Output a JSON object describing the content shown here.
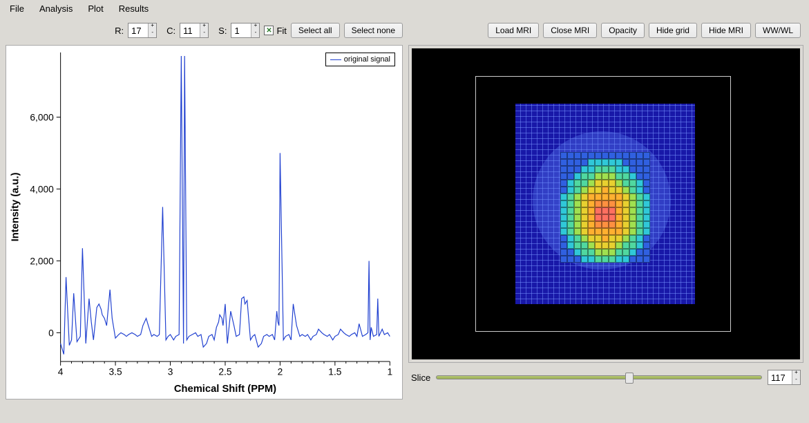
{
  "menu": {
    "file": "File",
    "analysis": "Analysis",
    "plot": "Plot",
    "results": "Results"
  },
  "spinners": {
    "r_label": "R:",
    "r_value": "17",
    "c_label": "C:",
    "c_value": "11",
    "s_label": "S:",
    "s_value": "1"
  },
  "fit_checkbox": {
    "label": "Fit",
    "checked": true
  },
  "buttons": {
    "select_all": "Select all",
    "select_none": "Select none",
    "load_mri": "Load MRI",
    "close_mri": "Close MRI",
    "opacity": "Opacity",
    "hide_grid": "Hide grid",
    "hide_mri": "Hide MRI",
    "wwwl": "WW/WL"
  },
  "legend": "original signal",
  "axes": {
    "x": "Chemical Shift (PPM)",
    "y": "Intensity (a.u.)"
  },
  "slice": {
    "label": "Slice",
    "value": "117"
  },
  "chart_data": {
    "type": "line",
    "title": "",
    "xlabel": "Chemical Shift (PPM)",
    "ylabel": "Intensity (a.u.)",
    "xlim": [
      4.0,
      1.0
    ],
    "ylim": [
      -800,
      7800
    ],
    "x_ticks": [
      4,
      3.5,
      3,
      2.5,
      2,
      1.5,
      1
    ],
    "y_ticks": [
      0,
      2000,
      4000,
      6000
    ],
    "y_tick_labels": [
      "0",
      "2,000",
      "4,000",
      "6,000"
    ],
    "series": [
      {
        "name": "original signal",
        "x": [
          4.0,
          3.97,
          3.95,
          3.92,
          3.9,
          3.88,
          3.85,
          3.82,
          3.8,
          3.77,
          3.74,
          3.72,
          3.7,
          3.67,
          3.65,
          3.63,
          3.62,
          3.6,
          3.58,
          3.55,
          3.53,
          3.5,
          3.47,
          3.45,
          3.42,
          3.4,
          3.38,
          3.35,
          3.32,
          3.3,
          3.27,
          3.25,
          3.22,
          3.2,
          3.17,
          3.15,
          3.12,
          3.1,
          3.07,
          3.04,
          3.02,
          3.0,
          2.97,
          2.95,
          2.92,
          2.9,
          2.88,
          2.87,
          2.85,
          2.83,
          2.8,
          2.77,
          2.75,
          2.72,
          2.7,
          2.67,
          2.65,
          2.62,
          2.6,
          2.58,
          2.56,
          2.55,
          2.53,
          2.52,
          2.5,
          2.48,
          2.45,
          2.42,
          2.4,
          2.37,
          2.35,
          2.33,
          2.32,
          2.3,
          2.27,
          2.25,
          2.23,
          2.2,
          2.17,
          2.15,
          2.12,
          2.1,
          2.07,
          2.05,
          2.03,
          2.02,
          2.01,
          2.0,
          1.97,
          1.95,
          1.92,
          1.9,
          1.88,
          1.87,
          1.85,
          1.82,
          1.8,
          1.77,
          1.75,
          1.72,
          1.7,
          1.67,
          1.65,
          1.62,
          1.6,
          1.57,
          1.55,
          1.52,
          1.5,
          1.47,
          1.45,
          1.42,
          1.4,
          1.37,
          1.35,
          1.32,
          1.3,
          1.28,
          1.25,
          1.22,
          1.2,
          1.19,
          1.18,
          1.17,
          1.15,
          1.12,
          1.11,
          1.1,
          1.07,
          1.05,
          1.02,
          1.0
        ],
        "y": [
          -300,
          -600,
          1550,
          -350,
          -200,
          1100,
          -250,
          -100,
          2350,
          -300,
          950,
          300,
          -200,
          700,
          800,
          650,
          500,
          400,
          200,
          1200,
          400,
          -150,
          -50,
          0,
          -50,
          -100,
          -50,
          0,
          -50,
          -100,
          -50,
          200,
          400,
          200,
          -100,
          -50,
          -100,
          -50,
          3500,
          -200,
          -100,
          -50,
          -200,
          -100,
          -50,
          7700,
          -300,
          7700,
          -200,
          -100,
          -50,
          0,
          -100,
          -50,
          -400,
          -300,
          -100,
          -50,
          -200,
          150,
          300,
          500,
          400,
          200,
          800,
          -300,
          600,
          200,
          -100,
          -50,
          950,
          1000,
          800,
          900,
          -200,
          -100,
          -50,
          -400,
          -300,
          -100,
          -50,
          -100,
          -50,
          -200,
          600,
          300,
          200,
          5000,
          -200,
          -100,
          -50,
          -200,
          800,
          600,
          200,
          -100,
          -50,
          -100,
          -50,
          -200,
          -100,
          -50,
          100,
          0,
          -50,
          -100,
          -50,
          -200,
          -100,
          -50,
          100,
          0,
          -50,
          -100,
          -50,
          0,
          -100,
          250,
          -100,
          -50,
          0,
          2000,
          -200,
          150,
          -100,
          -50,
          950,
          -100,
          100,
          -50,
          0,
          -100
        ]
      }
    ]
  }
}
